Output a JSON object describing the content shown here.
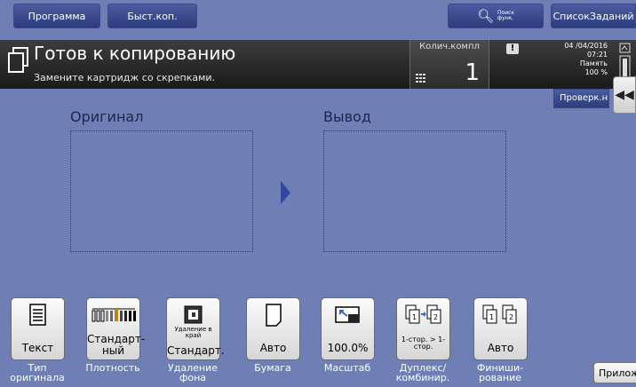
{
  "topbar": {
    "program": "Программа",
    "quick": "Быст.коп.",
    "search": "Поиск функ.",
    "search_line1": "Поиск",
    "search_line2": "функ.",
    "job_list": "СписокЗаданий"
  },
  "status": {
    "title": "Готов к копированию",
    "message": "Замените картридж со скрепками.",
    "count_label": "Колич.компл",
    "count_value": "1",
    "date": "04 /04/2016",
    "time": "07:21",
    "memory_label": "Память",
    "memory_value": "100 %",
    "warning_symbol": "!"
  },
  "side": {
    "check_label": "Проверк.н",
    "collapse_symbol": "◀◀"
  },
  "main": {
    "original_label": "Оригинал",
    "output_label": "Вывод"
  },
  "tiles": [
    {
      "value": "Текст",
      "caption": "Тип оригинала",
      "icon": "document-icon"
    },
    {
      "value": "Стандарт-ный",
      "caption": "Плотность",
      "icon": "density-icon"
    },
    {
      "value_small": "Удаление в край",
      "value": "Стандарт.",
      "caption": "Удаление фона",
      "icon": "background-removal-icon"
    },
    {
      "value": "Авто",
      "caption": "Бумага",
      "icon": "paper-icon"
    },
    {
      "value": "100.0%",
      "caption": "Масштаб",
      "icon": "zoom-icon"
    },
    {
      "value": "1-стор. > 1-стор.",
      "caption": "Дуплекс/ комбинир.",
      "icon": "duplex-icon"
    },
    {
      "value": "Авто",
      "caption": "Финиши-рование",
      "icon": "finishing-icon"
    }
  ],
  "app_button": "Приложение",
  "colors": {
    "background": "#6d7fb4",
    "status_bar": "#1f1f1f",
    "button": "#2c3c7c"
  }
}
